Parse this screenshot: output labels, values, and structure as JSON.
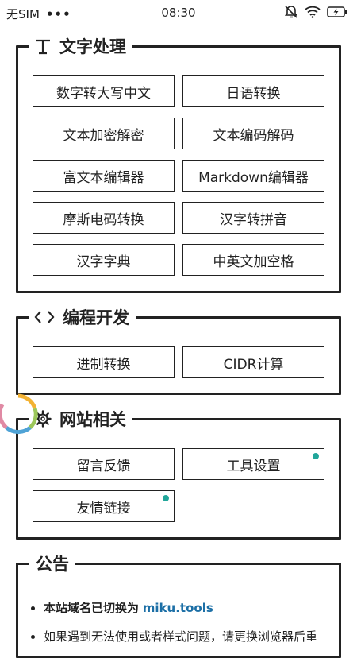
{
  "status_bar": {
    "carrier": "无SIM",
    "more": "•••",
    "time": "08:30"
  },
  "sections": {
    "text": {
      "title": "文字处理",
      "icon": "text-icon",
      "buttons": [
        "数字转大写中文",
        "日语转换",
        "文本加密解密",
        "文本编码解码",
        "富文本编辑器",
        "Markdown编辑器",
        "摩斯电码转换",
        "汉字转拼音",
        "汉字字典",
        "中英文加空格"
      ]
    },
    "dev": {
      "title": "编程开发",
      "icon": "code-icon",
      "buttons": [
        "进制转换",
        "CIDR计算"
      ]
    },
    "site": {
      "title": "网站相关",
      "icon": "gear-icon",
      "buttons": [
        "留言反馈",
        "工具设置",
        "友情链接"
      ],
      "dot_color": "#21a69a"
    },
    "notice": {
      "title": "公告",
      "item1_text": "本站域名已切换为",
      "item1_link": "miku.tools",
      "item2_text": "如果遇到无法使用或者样式问题，请更换浏览器后重"
    }
  },
  "colors": {
    "accent": "#21a69a",
    "link": "#1c6fa6",
    "border": "#222222"
  }
}
